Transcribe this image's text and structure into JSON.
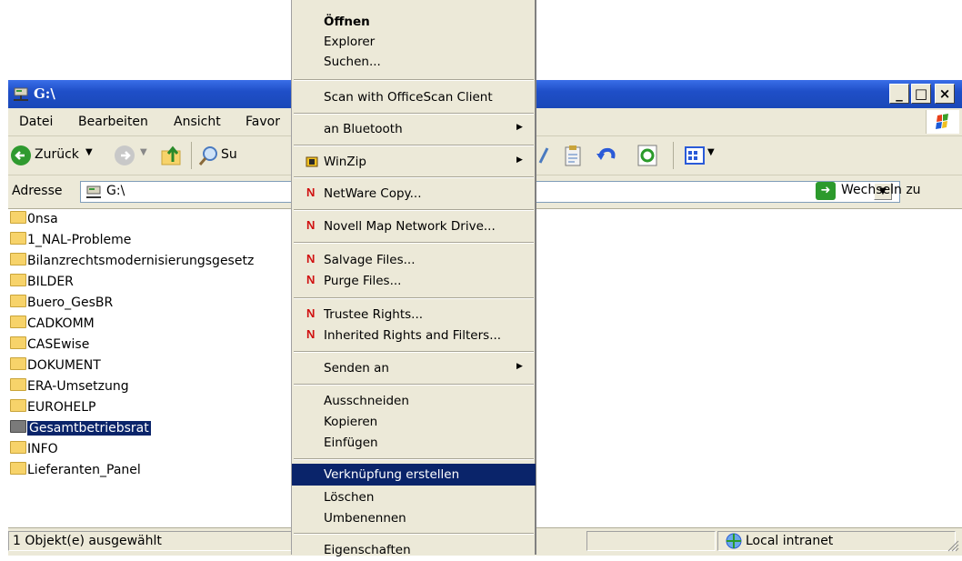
{
  "window": {
    "title": "G:\\",
    "menu": [
      "Datei",
      "Bearbeiten",
      "Ansicht",
      "Favor"
    ],
    "toolbar": {
      "back_label": "Zurück",
      "search_label": "Su"
    },
    "address": {
      "label": "Adresse",
      "value": "G:\\",
      "go_label": "Wechseln zu"
    },
    "files": [
      {
        "name": "0nsa"
      },
      {
        "name": "1_NAL-Probleme"
      },
      {
        "name": "Bilanzrechtsmodernisierungsgesetz"
      },
      {
        "name": "BILDER"
      },
      {
        "name": "Buero_GesBR"
      },
      {
        "name": "CADKOMM"
      },
      {
        "name": "CASEwise"
      },
      {
        "name": "DOKUMENT"
      },
      {
        "name": "ERA-Umsetzung"
      },
      {
        "name": "EUROHELP"
      },
      {
        "name": "Gesamtbetriebsrat",
        "selected": true
      },
      {
        "name": "INFO"
      },
      {
        "name": "Lieferanten_Panel"
      }
    ],
    "status": {
      "selection_text": "1 Objekt(e) ausgewählt",
      "zone": "Local intranet"
    }
  },
  "context_menu": {
    "open": "Öffnen",
    "explorer": "Explorer",
    "search": "Suchen...",
    "officescan": "Scan with OfficeScan Client",
    "bluetooth": "an Bluetooth",
    "winzip": "WinZip",
    "netware_copy": "NetWare Copy...",
    "novell_map": "Novell Map Network Drive...",
    "salvage": "Salvage Files...",
    "purge": "Purge Files...",
    "trustee": "Trustee Rights...",
    "inherited": "Inherited Rights and Filters...",
    "send_to": "Senden an",
    "cut": "Ausschneiden",
    "copy": "Kopieren",
    "paste": "Einfügen",
    "shortcut": "Verknüpfung erstellen",
    "delete": "Löschen",
    "rename": "Umbenennen",
    "properties": "Eigenschaften",
    "novell_icon_letter": "N"
  },
  "colors": {
    "titlebar": "#1f4fc8",
    "highlight": "#0a246a",
    "menu_bg": "#ece9d8"
  }
}
